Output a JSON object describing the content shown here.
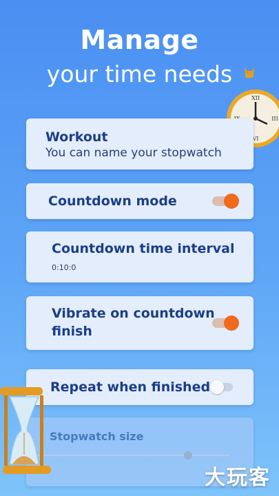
{
  "headline": {
    "line1": "Manage",
    "line2": "your time needs"
  },
  "settings": {
    "name": {
      "title": "Workout",
      "subtitle": "You can name your stopwatch"
    },
    "countdown_mode": {
      "label": "Countdown mode",
      "enabled": true
    },
    "countdown_interval": {
      "label": "Countdown time interval",
      "value": "0:10:0"
    },
    "vibrate": {
      "line1": "Vibrate on countdown",
      "line2": "finish",
      "enabled": true
    },
    "repeat": {
      "label": "Repeat when finished",
      "enabled": false
    },
    "size": {
      "label": "Stopwatch size",
      "level": 0.79
    }
  },
  "colors": {
    "accent": "#ef6a1a",
    "text": "#1c3e86",
    "card": "#e3edfc"
  },
  "watermark": "大玩客",
  "decorations": [
    "pocket-watch-icon",
    "hourglass-icon"
  ]
}
